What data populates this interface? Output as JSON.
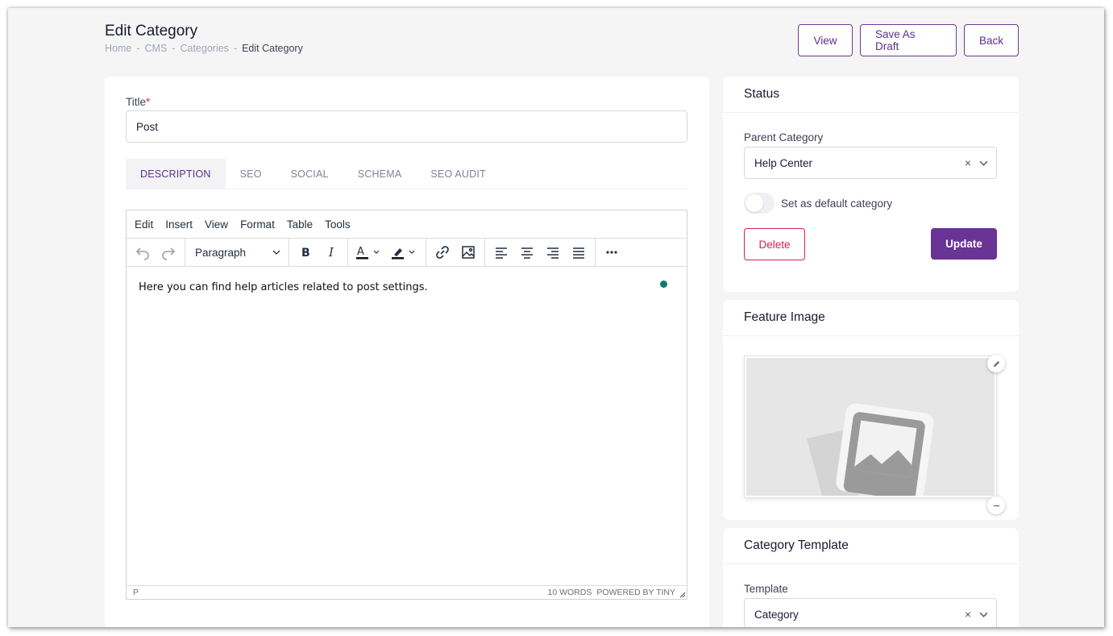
{
  "header": {
    "title": "Edit Category",
    "breadcrumb": [
      {
        "label": "Home",
        "sep": "-"
      },
      {
        "label": "CMS",
        "sep": "-"
      },
      {
        "label": "Categories",
        "sep": "-"
      },
      {
        "label": "Edit Category"
      }
    ],
    "buttons": {
      "view": "View",
      "save_draft": "Save As Draft",
      "back": "Back"
    }
  },
  "form": {
    "title_label": "Title",
    "required_mark": "*",
    "title_value": "Post",
    "tabs": [
      "DESCRIPTION",
      "SEO",
      "SOCIAL",
      "SCHEMA",
      "SEO AUDIT"
    ],
    "active_tab": "DESCRIPTION"
  },
  "editor": {
    "menu": [
      "Edit",
      "Insert",
      "View",
      "Format",
      "Table",
      "Tools"
    ],
    "block_format": "Paragraph",
    "content": "Here you can find help articles related to post settings.",
    "status_path": "P",
    "word_count": "10 WORDS",
    "powered_by": "POWERED BY TINY",
    "toolbar_icons": [
      "undo-icon",
      "redo-icon",
      "bold-icon",
      "italic-icon",
      "text-color-icon",
      "highlight-icon",
      "link-icon",
      "image-icon",
      "align-left-icon",
      "align-center-icon",
      "align-right-icon",
      "justify-icon",
      "more-icon"
    ]
  },
  "status_card": {
    "heading": "Status",
    "parent_label": "Parent Category",
    "parent_value": "Help Center",
    "default_toggle_label": "Set as default category",
    "default_toggle_on": false,
    "delete_label": "Delete",
    "update_label": "Update"
  },
  "feature_card": {
    "heading": "Feature Image"
  },
  "template_card": {
    "heading": "Category Template",
    "template_label": "Template",
    "template_value": "Category"
  },
  "colors": {
    "accent": "#6a3396",
    "danger": "#d9214e",
    "background": "#f5f5f5",
    "dot": "#0f7b6c"
  }
}
